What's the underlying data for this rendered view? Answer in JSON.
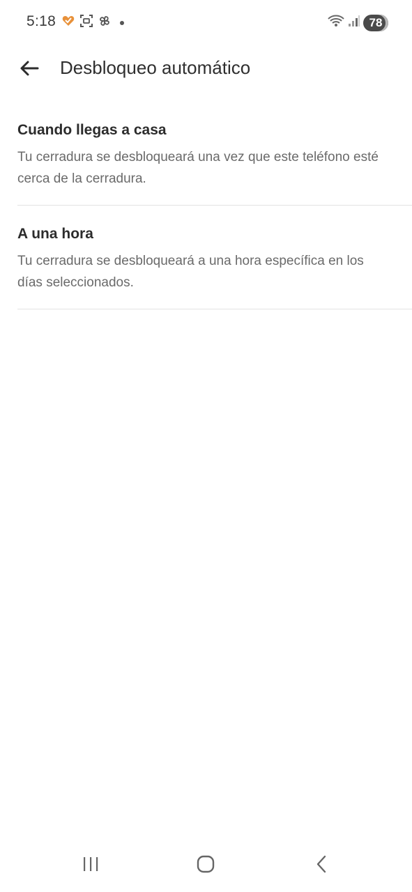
{
  "status_bar": {
    "time": "5:18",
    "battery": "78",
    "icons_left": [
      "heart-check-icon",
      "screenshot-icon",
      "pinwheel-icon",
      "dot-icon"
    ],
    "icons_right": [
      "wifi-icon",
      "signal-icon",
      "battery-icon"
    ]
  },
  "app_bar": {
    "title": "Desbloqueo automático",
    "back_icon": "back-arrow-icon"
  },
  "options": [
    {
      "title": "Cuando llegas a casa",
      "description": "Tu cerradura se desbloqueará una vez que este teléfono esté cerca de la cerradura."
    },
    {
      "title": "A una hora",
      "description": "Tu cerradura se desbloqueará a una hora específica en los días seleccionados."
    }
  ],
  "nav_bar": {
    "icons": [
      "recent-apps-icon",
      "home-icon",
      "back-icon"
    ]
  },
  "colors": {
    "accent_orange": "#e8913a",
    "text_primary": "#2c2c2c",
    "text_secondary": "#6a6a6a",
    "divider": "#e3e3e3"
  }
}
